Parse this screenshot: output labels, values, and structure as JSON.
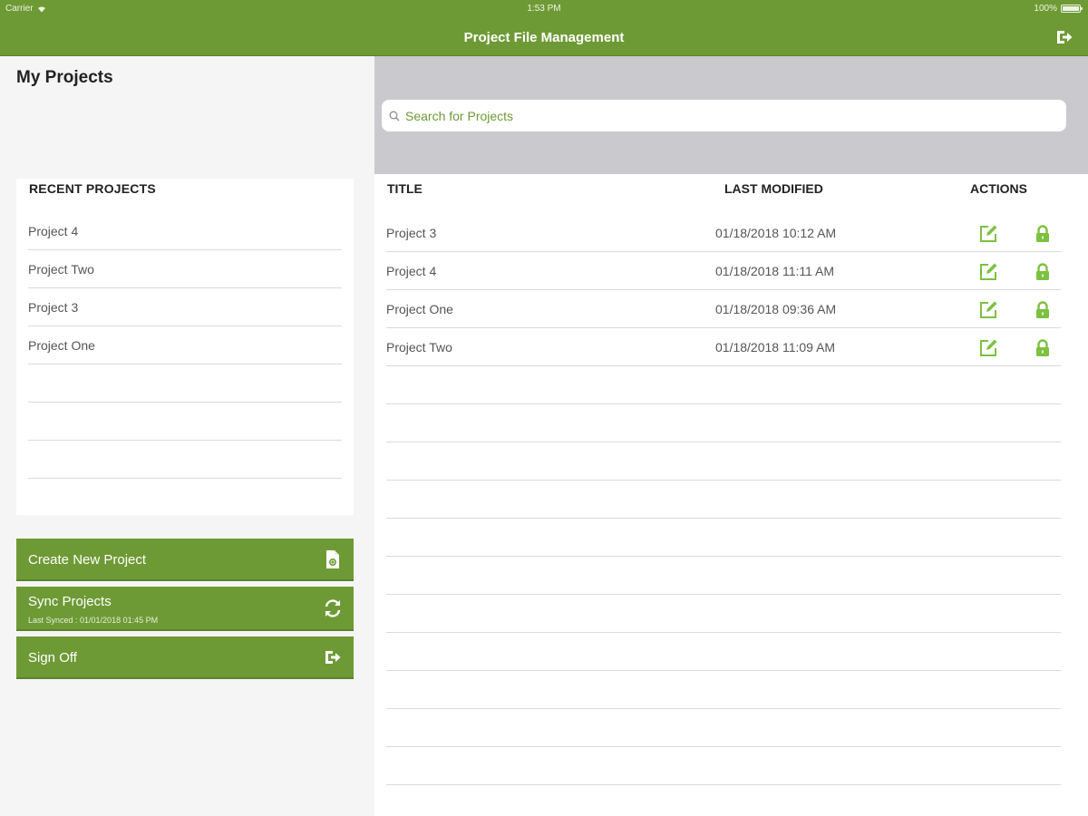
{
  "status_bar": {
    "carrier": "Carrier",
    "time": "1:53 PM",
    "battery": "100%"
  },
  "nav": {
    "title": "Project File Management",
    "signoff_icon": "sign-out-icon"
  },
  "left_panel": {
    "heading": "My Projects",
    "recent_header": "RECENT PROJECTS",
    "recent_items": [
      {
        "label": "Project 4"
      },
      {
        "label": "Project Two"
      },
      {
        "label": "Project 3"
      },
      {
        "label": "Project One"
      },
      {
        "label": ""
      },
      {
        "label": ""
      },
      {
        "label": ""
      }
    ],
    "buttons": {
      "create": {
        "label": "Create New Project",
        "icon": "new-file-icon"
      },
      "sync": {
        "label": "Sync Projects",
        "sub": "Last Synced : 01/01/2018 01:45 PM",
        "icon": "sync-icon"
      },
      "signoff": {
        "label": "Sign Off",
        "icon": "sign-out-icon"
      }
    }
  },
  "search": {
    "placeholder": "Search for Projects",
    "value": ""
  },
  "table": {
    "columns": {
      "title": "TITLE",
      "modified": "LAST MODIFIED",
      "actions": "ACTIONS"
    },
    "rows": [
      {
        "title": "Project 3",
        "modified": "01/18/2018 10:12 AM"
      },
      {
        "title": "Project 4",
        "modified": "01/18/2018 11:11 AM"
      },
      {
        "title": "Project One",
        "modified": "01/18/2018 09:36 AM"
      },
      {
        "title": "Project Two",
        "modified": "01/18/2018 11:09 AM"
      },
      {
        "title": "",
        "modified": ""
      },
      {
        "title": "",
        "modified": ""
      },
      {
        "title": "",
        "modified": ""
      },
      {
        "title": "",
        "modified": ""
      },
      {
        "title": "",
        "modified": ""
      },
      {
        "title": "",
        "modified": ""
      },
      {
        "title": "",
        "modified": ""
      },
      {
        "title": "",
        "modified": ""
      },
      {
        "title": "",
        "modified": ""
      },
      {
        "title": "",
        "modified": ""
      },
      {
        "title": "",
        "modified": ""
      }
    ]
  },
  "colors": {
    "accent": "#6e9a35",
    "search_bg": "#c9c9ce",
    "panel_bg": "#f5f5f5"
  }
}
